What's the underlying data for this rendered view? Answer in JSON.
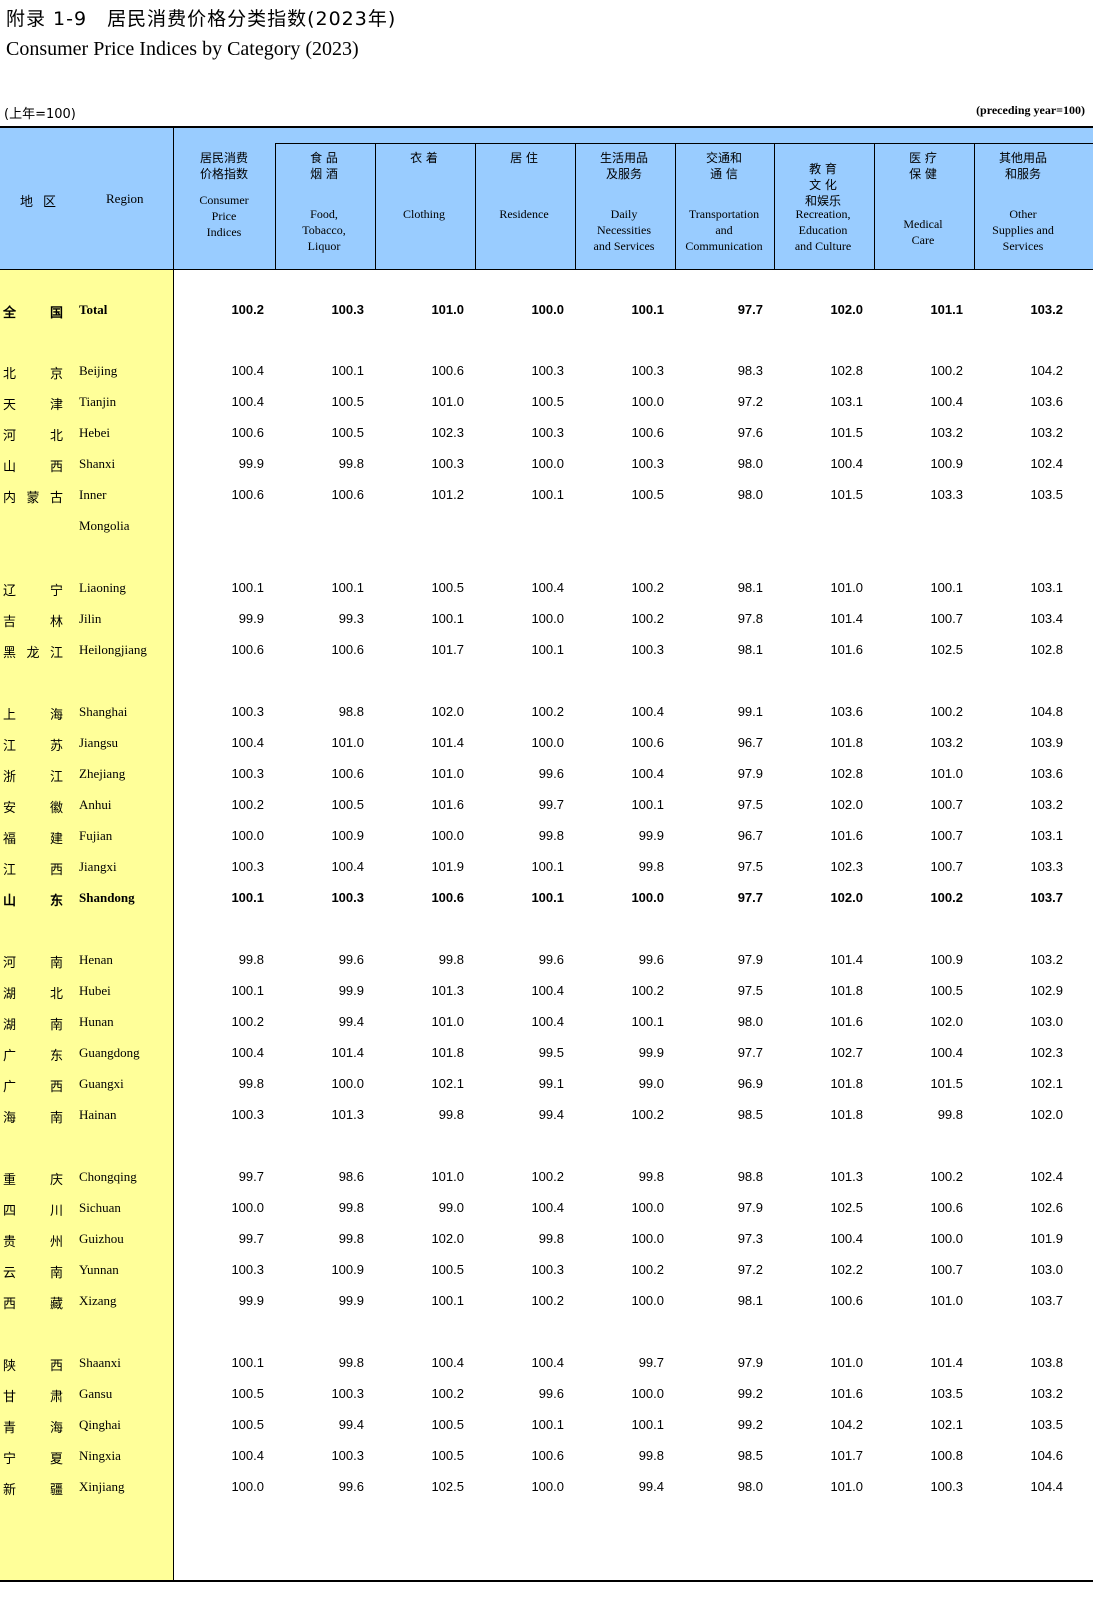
{
  "title": {
    "zh": "附录 1-9　居民消费价格分类指数(2023年)",
    "en": "Consumer Price Indices by Category (2023)"
  },
  "unit": {
    "zh": "(上年=100)",
    "en": "(preceding year=100)"
  },
  "region_header": {
    "zh": "地区",
    "en": "Region"
  },
  "columns": [
    {
      "key": "cpi",
      "zh": "居民消费\n价格指数",
      "en": "Consumer\nPrice\nIndices"
    },
    {
      "key": "food",
      "zh": "食 品\n烟 酒",
      "en": "Food,\nTobacco,\nLiquor"
    },
    {
      "key": "clothing",
      "zh": "衣 着",
      "en": "Clothing"
    },
    {
      "key": "residence",
      "zh": "居 住",
      "en": "Residence"
    },
    {
      "key": "daily",
      "zh": "生活用品\n及服务",
      "en": "Daily\nNecessities\nand Services"
    },
    {
      "key": "transport",
      "zh": "交通和\n通 信",
      "en": "Transportation\nand\nCommunication"
    },
    {
      "key": "education",
      "zh": "教 育\n文 化\n和娱乐",
      "en": "Recreation,\nEducation\nand Culture"
    },
    {
      "key": "medical",
      "zh": "医 疗\n保 健",
      "en": "Medical\nCare"
    },
    {
      "key": "other",
      "zh": "其他用品\n和服务",
      "en": "Other\nSupplies and\nServices"
    }
  ],
  "rows": [
    {
      "zh": [
        "全",
        "国"
      ],
      "en": "Total",
      "values": [
        "100.2",
        "100.3",
        "101.0",
        "100.0",
        "100.1",
        "97.7",
        "102.0",
        "101.1",
        "103.2"
      ],
      "bold": true
    },
    {
      "zh": [
        "北",
        "京"
      ],
      "en": "Beijing",
      "values": [
        "100.4",
        "100.1",
        "100.6",
        "100.3",
        "100.3",
        "98.3",
        "102.8",
        "100.2",
        "104.2"
      ]
    },
    {
      "zh": [
        "天",
        "津"
      ],
      "en": "Tianjin",
      "values": [
        "100.4",
        "100.5",
        "101.0",
        "100.5",
        "100.0",
        "97.2",
        "103.1",
        "100.4",
        "103.6"
      ]
    },
    {
      "zh": [
        "河",
        "北"
      ],
      "en": "Hebei",
      "values": [
        "100.6",
        "100.5",
        "102.3",
        "100.3",
        "100.6",
        "97.6",
        "101.5",
        "103.2",
        "103.2"
      ]
    },
    {
      "zh": [
        "山",
        "西"
      ],
      "en": "Shanxi",
      "values": [
        "99.9",
        "99.8",
        "100.3",
        "100.0",
        "100.3",
        "98.0",
        "100.4",
        "100.9",
        "102.4"
      ]
    },
    {
      "zh": [
        "内",
        "蒙",
        "古"
      ],
      "en": "Inner",
      "en2": "Mongolia",
      "values": [
        "100.6",
        "100.6",
        "101.2",
        "100.1",
        "100.5",
        "98.0",
        "101.5",
        "103.3",
        "103.5"
      ]
    },
    {
      "zh": [
        "辽",
        "宁"
      ],
      "en": "Liaoning",
      "values": [
        "100.1",
        "100.1",
        "100.5",
        "100.4",
        "100.2",
        "98.1",
        "101.0",
        "100.1",
        "103.1"
      ]
    },
    {
      "zh": [
        "吉",
        "林"
      ],
      "en": "Jilin",
      "values": [
        "99.9",
        "99.3",
        "100.1",
        "100.0",
        "100.2",
        "97.8",
        "101.4",
        "100.7",
        "103.4"
      ]
    },
    {
      "zh": [
        "黑",
        "龙",
        "江"
      ],
      "en": "Heilongjiang",
      "values": [
        "100.6",
        "100.6",
        "101.7",
        "100.1",
        "100.3",
        "98.1",
        "101.6",
        "102.5",
        "102.8"
      ]
    },
    {
      "zh": [
        "上",
        "海"
      ],
      "en": "Shanghai",
      "values": [
        "100.3",
        "98.8",
        "102.0",
        "100.2",
        "100.4",
        "99.1",
        "103.6",
        "100.2",
        "104.8"
      ]
    },
    {
      "zh": [
        "江",
        "苏"
      ],
      "en": "Jiangsu",
      "values": [
        "100.4",
        "101.0",
        "101.4",
        "100.0",
        "100.6",
        "96.7",
        "101.8",
        "103.2",
        "103.9"
      ]
    },
    {
      "zh": [
        "浙",
        "江"
      ],
      "en": "Zhejiang",
      "values": [
        "100.3",
        "100.6",
        "101.0",
        "99.6",
        "100.4",
        "97.9",
        "102.8",
        "101.0",
        "103.6"
      ]
    },
    {
      "zh": [
        "安",
        "徽"
      ],
      "en": "Anhui",
      "values": [
        "100.2",
        "100.5",
        "101.6",
        "99.7",
        "100.1",
        "97.5",
        "102.0",
        "100.7",
        "103.2"
      ]
    },
    {
      "zh": [
        "福",
        "建"
      ],
      "en": "Fujian",
      "values": [
        "100.0",
        "100.9",
        "100.0",
        "99.8",
        "99.9",
        "96.7",
        "101.6",
        "100.7",
        "103.1"
      ]
    },
    {
      "zh": [
        "江",
        "西"
      ],
      "en": "Jiangxi",
      "values": [
        "100.3",
        "100.4",
        "101.9",
        "100.1",
        "99.8",
        "97.5",
        "102.3",
        "100.7",
        "103.3"
      ]
    },
    {
      "zh": [
        "山",
        "东"
      ],
      "en": "Shandong",
      "values": [
        "100.1",
        "100.3",
        "100.6",
        "100.1",
        "100.0",
        "97.7",
        "102.0",
        "100.2",
        "103.7"
      ],
      "bold": true
    },
    {
      "zh": [
        "河",
        "南"
      ],
      "en": "Henan",
      "values": [
        "99.8",
        "99.6",
        "99.8",
        "99.6",
        "99.6",
        "97.9",
        "101.4",
        "100.9",
        "103.2"
      ]
    },
    {
      "zh": [
        "湖",
        "北"
      ],
      "en": "Hubei",
      "values": [
        "100.1",
        "99.9",
        "101.3",
        "100.4",
        "100.2",
        "97.5",
        "101.8",
        "100.5",
        "102.9"
      ]
    },
    {
      "zh": [
        "湖",
        "南"
      ],
      "en": "Hunan",
      "values": [
        "100.2",
        "99.4",
        "101.0",
        "100.4",
        "100.1",
        "98.0",
        "101.6",
        "102.0",
        "103.0"
      ]
    },
    {
      "zh": [
        "广",
        "东"
      ],
      "en": "Guangdong",
      "values": [
        "100.4",
        "101.4",
        "101.8",
        "99.5",
        "99.9",
        "97.7",
        "102.7",
        "100.4",
        "102.3"
      ]
    },
    {
      "zh": [
        "广",
        "西"
      ],
      "en": "Guangxi",
      "values": [
        "99.8",
        "100.0",
        "102.1",
        "99.1",
        "99.0",
        "96.9",
        "101.8",
        "101.5",
        "102.1"
      ]
    },
    {
      "zh": [
        "海",
        "南"
      ],
      "en": "Hainan",
      "values": [
        "100.3",
        "101.3",
        "99.8",
        "99.4",
        "100.2",
        "98.5",
        "101.8",
        "99.8",
        "102.0"
      ]
    },
    {
      "zh": [
        "重",
        "庆"
      ],
      "en": "Chongqing",
      "values": [
        "99.7",
        "98.6",
        "101.0",
        "100.2",
        "99.8",
        "98.8",
        "101.3",
        "100.2",
        "102.4"
      ]
    },
    {
      "zh": [
        "四",
        "川"
      ],
      "en": "Sichuan",
      "values": [
        "100.0",
        "99.8",
        "99.0",
        "100.4",
        "100.0",
        "97.9",
        "102.5",
        "100.6",
        "102.6"
      ]
    },
    {
      "zh": [
        "贵",
        "州"
      ],
      "en": "Guizhou",
      "values": [
        "99.7",
        "99.8",
        "102.0",
        "99.8",
        "100.0",
        "97.3",
        "100.4",
        "100.0",
        "101.9"
      ]
    },
    {
      "zh": [
        "云",
        "南"
      ],
      "en": "Yunnan",
      "values": [
        "100.3",
        "100.9",
        "100.5",
        "100.3",
        "100.2",
        "97.2",
        "102.2",
        "100.7",
        "103.0"
      ]
    },
    {
      "zh": [
        "西",
        "藏"
      ],
      "en": "Xizang",
      "values": [
        "99.9",
        "99.9",
        "100.1",
        "100.2",
        "100.0",
        "98.1",
        "100.6",
        "101.0",
        "103.7"
      ]
    },
    {
      "zh": [
        "陕",
        "西"
      ],
      "en": "Shaanxi",
      "values": [
        "100.1",
        "99.8",
        "100.4",
        "100.4",
        "99.7",
        "97.9",
        "101.0",
        "101.4",
        "103.8"
      ]
    },
    {
      "zh": [
        "甘",
        "肃"
      ],
      "en": "Gansu",
      "values": [
        "100.5",
        "100.3",
        "100.2",
        "99.6",
        "100.0",
        "99.2",
        "101.6",
        "103.5",
        "103.2"
      ]
    },
    {
      "zh": [
        "青",
        "海"
      ],
      "en": "Qinghai",
      "values": [
        "100.5",
        "99.4",
        "100.5",
        "100.1",
        "100.1",
        "99.2",
        "104.2",
        "102.1",
        "103.5"
      ]
    },
    {
      "zh": [
        "宁",
        "夏"
      ],
      "en": "Ningxia",
      "values": [
        "100.4",
        "100.3",
        "100.5",
        "100.6",
        "99.8",
        "98.5",
        "101.7",
        "100.8",
        "104.6"
      ]
    },
    {
      "zh": [
        "新",
        "疆"
      ],
      "en": "Xinjiang",
      "values": [
        "100.0",
        "99.6",
        "102.5",
        "100.0",
        "99.4",
        "98.0",
        "101.0",
        "100.3",
        "104.4"
      ]
    }
  ]
}
